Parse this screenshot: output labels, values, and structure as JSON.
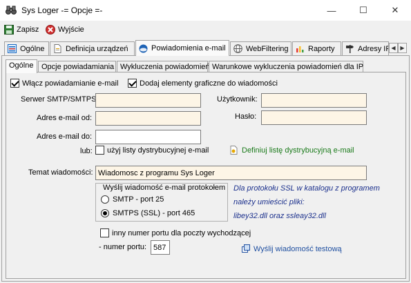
{
  "window": {
    "title": "Sys Loger -= Opcje =-",
    "minimize_glyph": "—",
    "maximize_glyph": "☐",
    "close_glyph": "✕"
  },
  "toolbar": {
    "save_label": "Zapisz",
    "exit_label": "Wyjście"
  },
  "main_tabs": [
    {
      "label": "Ogólne"
    },
    {
      "label": "Definicja urządzeń"
    },
    {
      "label": "Powiadomienia e-mail"
    },
    {
      "label": "WebFiltering"
    },
    {
      "label": "Raporty"
    },
    {
      "label": "Adresy IP"
    }
  ],
  "tab_scroll": {
    "left": "◀",
    "right": "▶"
  },
  "sub_tabs": [
    {
      "label": "Ogólne"
    },
    {
      "label": "Opcje powiadamiania"
    },
    {
      "label": "Wykluczenia powiadomień"
    },
    {
      "label": "Warunkowe wykluczenia powiadomień dla IP"
    }
  ],
  "form": {
    "enable_email_label": "Włącz powiadamianie e-mail",
    "add_graphics_label": "Dodaj elementy graficzne do wiadomości",
    "smtp_server_label": "Serwer SMTP/SMTPS:",
    "smtp_server_value": "",
    "user_label": "Użytkownik:",
    "user_value": "",
    "from_label": "Adres e-mail od:",
    "from_value": "",
    "password_label": "Hasło:",
    "password_value": "",
    "to_label": "Adres e-mail do:",
    "to_value": "",
    "or_label": "lub:",
    "use_dist_list_label": "użyj listy dystrybucyjnej e-mail",
    "define_dist_list_link": "Definiuj listę dystrybucyjną e-mail",
    "subject_label": "Temat wiadomości:",
    "subject_value": "Wiadomosc z programu Sys Loger",
    "protocol_group_title": "Wyślij wiadomość e-mail protokołem",
    "protocol_smtp_label": "SMTP - port 25",
    "protocol_smtps_label": "SMTPS (SSL) - port 465",
    "ssl_info_line1": "Dla protokołu SSL w katalogu z programem",
    "ssl_info_line2": "należy umieścić pliki:",
    "ssl_info_line3": "libey32.dll oraz ssleay32.dll",
    "other_port_label": "inny numer portu dla poczty wychodzącej",
    "port_number_label": "- numer portu:",
    "port_number_value": "587",
    "send_test_link": "Wyślij wiadomość testową"
  },
  "colors": {
    "field_bg": "#fdf5e6",
    "link_green": "#1a7a1a",
    "link_blue": "#1f4fa0",
    "info_text": "#1a2f8c"
  }
}
